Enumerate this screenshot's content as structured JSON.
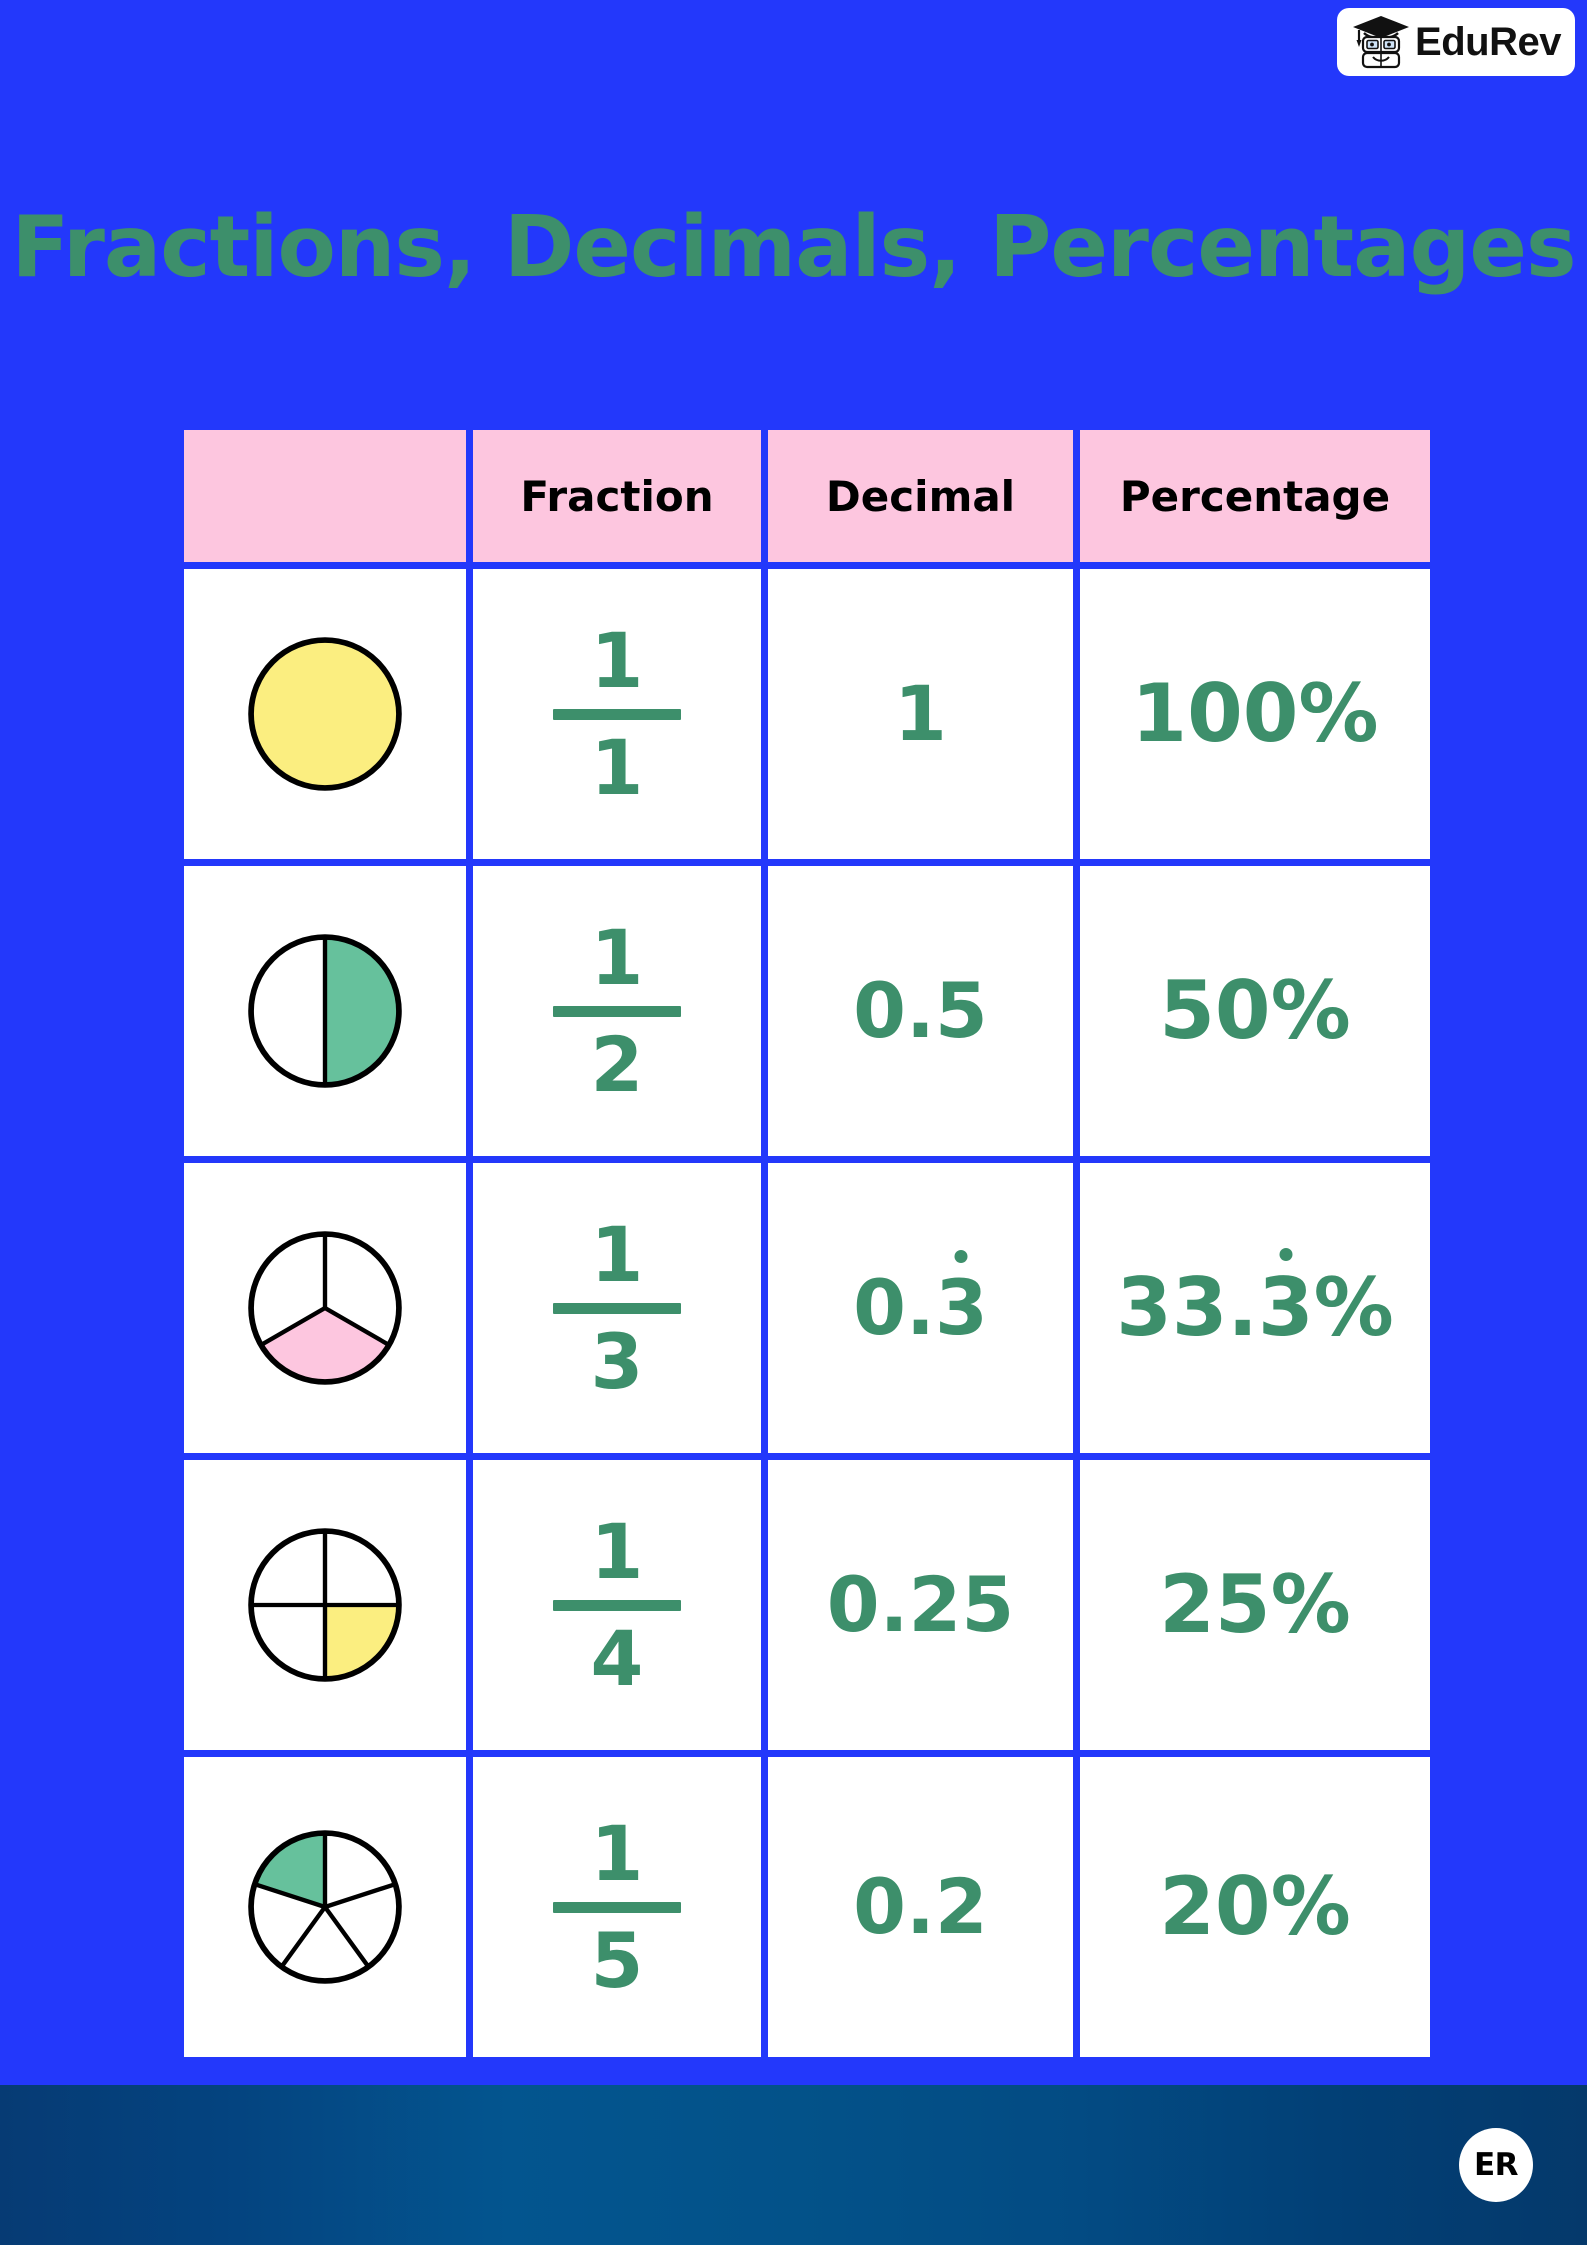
{
  "brand": {
    "logo_text": "EduRev",
    "logo_icon": "graduate-robot-icon",
    "footer_badge": "ER"
  },
  "title": "Fractions, Decimals, Percentages",
  "table": {
    "headers": [
      "",
      "Fraction",
      "Decimal",
      "Percentage"
    ],
    "rows": [
      {
        "shape": {
          "icon": "circle-1-of-1-icon",
          "parts": 1,
          "shaded": 1,
          "fill": "#fbee80"
        },
        "numerator": "1",
        "denominator": "1",
        "decimal": "1",
        "decimal_recurring": "",
        "percentage": "100%",
        "percentage_recurring": ""
      },
      {
        "shape": {
          "icon": "circle-1-of-2-icon",
          "parts": 2,
          "shaded": 1,
          "fill": "#66c19c"
        },
        "numerator": "1",
        "denominator": "2",
        "decimal": "0.5",
        "decimal_recurring": "",
        "percentage": "50%",
        "percentage_recurring": ""
      },
      {
        "shape": {
          "icon": "circle-1-of-3-icon",
          "parts": 3,
          "shaded": 1,
          "fill": "#fdc6df"
        },
        "numerator": "1",
        "denominator": "3",
        "decimal": "0.",
        "decimal_recurring": "3",
        "percentage": "33.",
        "percentage_recurring": "3",
        "percentage_suffix": "%"
      },
      {
        "shape": {
          "icon": "circle-1-of-4-icon",
          "parts": 4,
          "shaded": 1,
          "fill": "#fbee80"
        },
        "numerator": "1",
        "denominator": "4",
        "decimal": "0.25",
        "decimal_recurring": "",
        "percentage": "25%",
        "percentage_recurring": ""
      },
      {
        "shape": {
          "icon": "circle-1-of-5-icon",
          "parts": 5,
          "shaded": 1,
          "fill": "#66c19c"
        },
        "numerator": "1",
        "denominator": "5",
        "decimal": "0.2",
        "decimal_recurring": "",
        "percentage": "20%",
        "percentage_recurring": ""
      }
    ]
  },
  "colors": {
    "background": "#2338fb",
    "header_pink": "#fdc6df",
    "text_green": "#3d8f6b",
    "shade_yellow": "#fbee80",
    "shade_green": "#66c19c",
    "shade_pink": "#fdc6df",
    "cell_white": "#ffffff"
  }
}
